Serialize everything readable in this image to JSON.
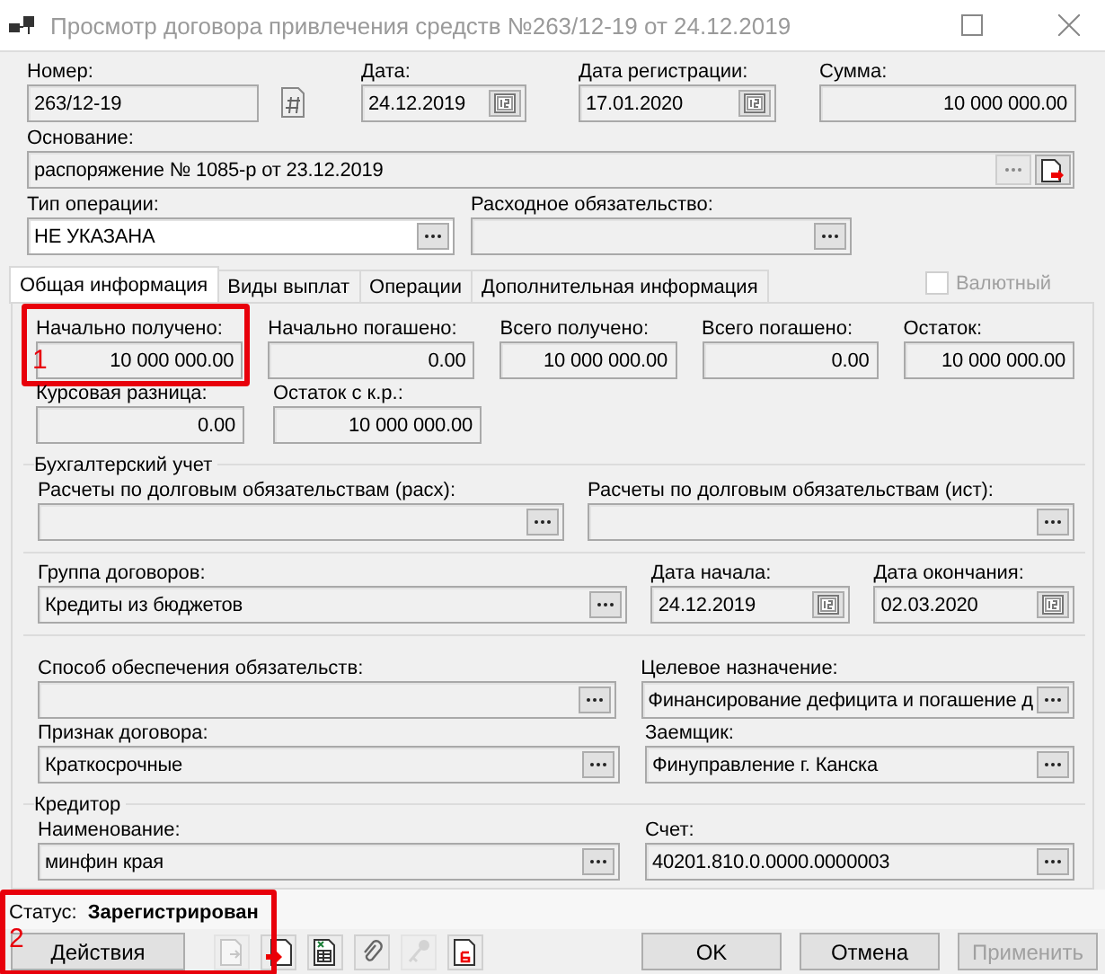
{
  "window": {
    "title": "Просмотр договора привлечения средств №263/12-19 от 24.12.2019"
  },
  "header": {
    "number": {
      "label": "Номер:",
      "value": "263/12-19",
      "readonly": true
    },
    "date": {
      "label": "Дата:",
      "value": "24.12.2019",
      "kind": "date",
      "readonly": true
    },
    "reg_date": {
      "label": "Дата регистрации:",
      "value": "17.01.2020",
      "kind": "date",
      "readonly": true
    },
    "sum": {
      "label": "Сумма:",
      "value": "10 000 000.00",
      "readonly": true
    },
    "basis": {
      "label": "Основание:",
      "value": "распоряжение № 1085-р от 23.12.2019",
      "readonly": true
    },
    "operation_type": {
      "label": "Тип операции:",
      "value": "НЕ УКАЗАНА",
      "kind": "lookup",
      "readonly": false
    },
    "expense_obligation": {
      "label": "Расходное обязательство:",
      "kind": "lookup",
      "readonly": true
    }
  },
  "tabs": [
    {
      "label": "Общая информация",
      "selected": true
    },
    {
      "label": "Виды выплат",
      "selected": false
    },
    {
      "label": "Операции",
      "selected": false
    },
    {
      "label": "Дополнительная информация",
      "selected": false
    }
  ],
  "currency_checkbox": {
    "label": "Валютный",
    "checked": false,
    "disabled": true
  },
  "general": {
    "amounts": [
      {
        "label": "Начально получено:",
        "value": "10 000 000.00",
        "annotation": "1"
      },
      {
        "label": "Начально погашено:",
        "value": "0.00"
      },
      {
        "label": "Всего получено:",
        "value": "10 000 000.00"
      },
      {
        "label": "Всего погашено:",
        "value": "0.00"
      },
      {
        "label": "Остаток:",
        "value": "10 000 000.00"
      }
    ],
    "amounts2": [
      {
        "label": "Курсовая разница:",
        "value": "0.00"
      },
      {
        "label": "Остаток с к.р.:",
        "value": "10 000 000.00"
      }
    ],
    "accounting": {
      "title": "Бухгалтерский учет",
      "fields": [
        {
          "label": "Расчеты по долговым обязательствам (расх):",
          "kind": "lookup",
          "readonly": true
        },
        {
          "label": "Расчеты по долговым обязательствам (ист):",
          "kind": "lookup",
          "readonly": true
        }
      ]
    },
    "contract_group": {
      "label": "Группа договоров:",
      "value": "Кредиты из бюджетов",
      "kind": "lookup",
      "readonly": true
    },
    "start_date": {
      "label": "Дата начала:",
      "value": "24.12.2019",
      "kind": "date",
      "readonly": true
    },
    "end_date": {
      "label": "Дата окончания:",
      "value": "02.03.2020",
      "kind": "date",
      "readonly": true
    },
    "security": {
      "label": "Способ обеспечения обязательств:",
      "kind": "lookup",
      "readonly": true
    },
    "purpose": {
      "label": "Целевое назначение:",
      "value": "Финансирование дефицита и погашение д",
      "kind": "lookup",
      "readonly": true
    },
    "sign": {
      "label": "Признак договора:",
      "value": "Краткосрочные",
      "kind": "lookup",
      "readonly": true
    },
    "borrower": {
      "label": "Заемщик:",
      "value": "Финуправление г. Канска",
      "kind": "lookup",
      "readonly": true
    },
    "creditor": {
      "title": "Кредитор",
      "name": {
        "label": "Наименование:",
        "value": "минфин края",
        "kind": "lookup",
        "readonly": true
      },
      "account": {
        "label": "Счет:",
        "value": "40201.810.0.0000.0000003",
        "kind": "lookup",
        "readonly": true
      }
    }
  },
  "status": {
    "label": "Статус:",
    "value": "Зарегистрирован",
    "annotation": "2"
  },
  "actions_button": {
    "label": "Действия"
  },
  "toolbar_icons": [
    {
      "kind": "export",
      "disabled": true
    },
    {
      "kind": "import",
      "disabled": false
    },
    {
      "kind": "excel",
      "disabled": false
    },
    {
      "kind": "attach",
      "disabled": false
    },
    {
      "kind": "key",
      "disabled": true
    },
    {
      "kind": "print",
      "disabled": false
    }
  ],
  "buttons": [
    {
      "label": "OK",
      "disabled": false
    },
    {
      "label": "Отмена",
      "disabled": false
    },
    {
      "label": "Применить",
      "disabled": true
    }
  ]
}
